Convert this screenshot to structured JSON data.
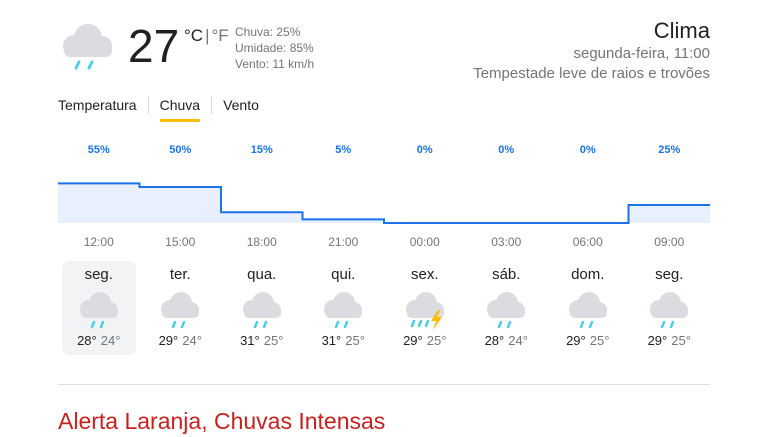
{
  "current": {
    "icon": "rain-cloud-icon",
    "temperature": "27",
    "unit_c": "°C",
    "unit_f": "°F",
    "unit_separator": "|",
    "chuva": "Chuva: 25%",
    "umidade": "Umidade: 85%",
    "vento": "Vento: 11 km/h"
  },
  "header": {
    "title": "Clima",
    "datetime": "segunda-feira, 11:00",
    "description": "Tempestade leve de raios e trovões"
  },
  "tabs": [
    {
      "label": "Temperatura",
      "active": false
    },
    {
      "label": "Chuva",
      "active": true
    },
    {
      "label": "Vento",
      "active": false
    }
  ],
  "chart_data": {
    "type": "area",
    "title": "",
    "xlabel": "",
    "ylabel": "",
    "x": [
      "12:00",
      "15:00",
      "18:00",
      "21:00",
      "00:00",
      "03:00",
      "06:00",
      "09:00"
    ],
    "series": [
      {
        "values": [
          55,
          50,
          15,
          5,
          0,
          0,
          0,
          25
        ]
      }
    ],
    "labels": [
      "55%",
      "50%",
      "15%",
      "5%",
      "0%",
      "0%",
      "0%",
      "25%"
    ],
    "ylim": [
      0,
      100
    ],
    "colors": {
      "line": "#1a73e8",
      "fill": "#e8f0fe",
      "label": "#1a73e8"
    }
  },
  "days": [
    {
      "name": "seg.",
      "icon": "rain-icon",
      "high": "28°",
      "low": "24°",
      "selected": true
    },
    {
      "name": "ter.",
      "icon": "rain-icon",
      "high": "29°",
      "low": "24°",
      "selected": false
    },
    {
      "name": "qua.",
      "icon": "rain-icon",
      "high": "31°",
      "low": "25°",
      "selected": false
    },
    {
      "name": "qui.",
      "icon": "rain-icon",
      "high": "31°",
      "low": "25°",
      "selected": false
    },
    {
      "name": "sex.",
      "icon": "thunderstorm-icon",
      "high": "29°",
      "low": "25°",
      "selected": false
    },
    {
      "name": "sáb.",
      "icon": "rain-icon",
      "high": "28°",
      "low": "24°",
      "selected": false
    },
    {
      "name": "dom.",
      "icon": "rain-icon",
      "high": "29°",
      "low": "25°",
      "selected": false
    },
    {
      "name": "seg.",
      "icon": "rain-icon",
      "high": "29°",
      "low": "25°",
      "selected": false
    }
  ],
  "alert": {
    "label": "Alerta Laranja, Chuvas Intensas",
    "color": "#c5221f"
  }
}
